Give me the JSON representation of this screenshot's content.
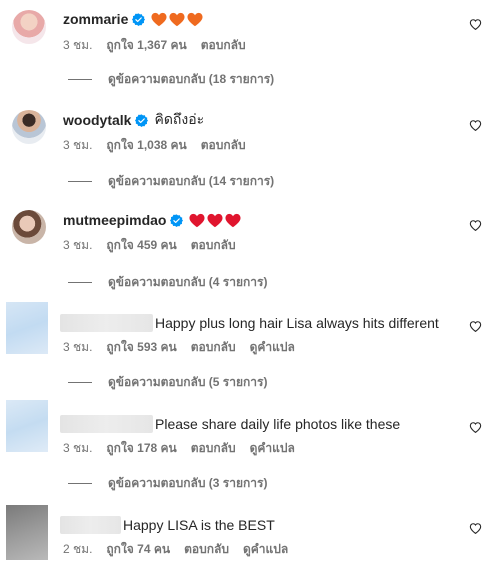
{
  "colors": {
    "verified": "#0095f6",
    "text_primary": "#262626",
    "text_secondary": "#737373",
    "heart_orange": "#ef6a1f",
    "heart_red": "#e0152e"
  },
  "comments": [
    {
      "username": "zommarie",
      "verified": true,
      "text": "",
      "emoji": "orange-heart x3",
      "time": "3 ชม.",
      "likes": "ถูกใจ 1,367 คน",
      "reply": "ตอบกลับ",
      "view_replies": "ดูข้อความตอบกลับ (18 รายการ)"
    },
    {
      "username": "woodytalk",
      "verified": true,
      "text": "คิดถึงอ่ะ",
      "time": "3 ชม.",
      "likes": "ถูกใจ 1,038 คน",
      "reply": "ตอบกลับ",
      "view_replies": "ดูข้อความตอบกลับ (14 รายการ)"
    },
    {
      "username": "mutmeepimdao",
      "verified": true,
      "text": "",
      "emoji": "red-heart x3",
      "time": "3 ชม.",
      "likes": "ถูกใจ 459 คน",
      "reply": "ตอบกลับ",
      "view_replies": "ดูข้อความตอบกลับ (4 รายการ)"
    },
    {
      "username": "",
      "text": "Happy plus long hair Lisa always hits different",
      "time": "3 ชม.",
      "likes": "ถูกใจ 593 คน",
      "reply": "ตอบกลับ",
      "translate": "ดูคำแปล",
      "view_replies": "ดูข้อความตอบกลับ (5 รายการ)"
    },
    {
      "username": "",
      "text": "Please share daily life photos like these",
      "time": "3 ชม.",
      "likes": "ถูกใจ 178 คน",
      "reply": "ตอบกลับ",
      "translate": "ดูคำแปล",
      "view_replies": "ดูข้อความตอบกลับ (3 รายการ)"
    },
    {
      "username": "",
      "text": "Happy LISA is the BEST",
      "time": "2 ชม.",
      "likes": "ถูกใจ 74 คน",
      "reply": "ตอบกลับ",
      "translate": "ดูคำแปล"
    }
  ]
}
